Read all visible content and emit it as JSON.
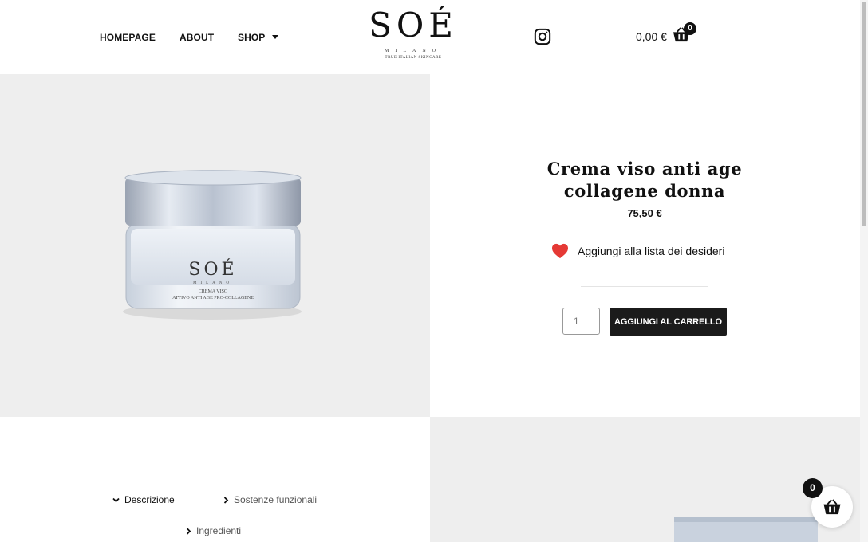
{
  "header": {
    "nav": [
      {
        "label": "HOMEPAGE"
      },
      {
        "label": "ABOUT"
      },
      {
        "label": "SHOP"
      }
    ],
    "logo": {
      "main": "SOÉ",
      "sub": "MILANO",
      "tagline": "TRUE ITALIAN SKINCARE"
    },
    "social_icon": "instagram-icon",
    "cart": {
      "total": "0,00 €",
      "count": "0",
      "icon": "basket-icon"
    }
  },
  "product": {
    "image_brand": "SOÉ",
    "image_brand_sub": "MILANO",
    "image_line1": "CREMA VISO",
    "image_line2": "ATTIVO ANTI AGE PRO-COLLAGENE",
    "title_line1": "Crema viso anti age",
    "title_line2": "collagene donna",
    "price": "75,50 €",
    "wishlist_label": "Aggiungi alla lista dei desideri",
    "quantity": "1",
    "add_to_cart_label": "AGGIUNGI AL CARRELLO"
  },
  "tabs": [
    {
      "label": "Descrizione",
      "state": "open"
    },
    {
      "label": "Sostenze funzionali",
      "state": "closed"
    },
    {
      "label": "Ingredienti",
      "state": "closed"
    }
  ],
  "floating_cart": {
    "count": "0"
  },
  "colors": {
    "accent": "#1b1b1b",
    "panel_background": "#eeeeee",
    "heart": "#e53935"
  }
}
